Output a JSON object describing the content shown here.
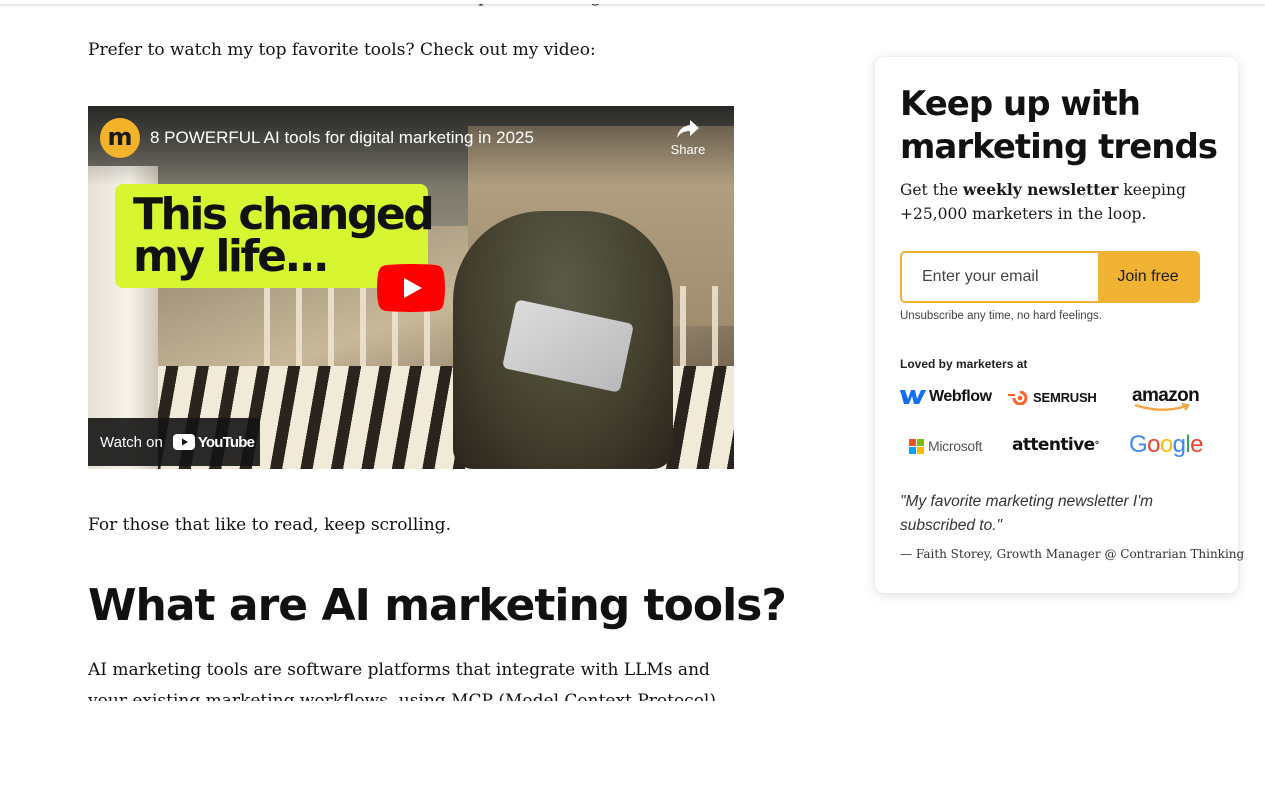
{
  "article": {
    "clipped_line": "Whether to save time, find new ideas or cheaper marketing execution.",
    "intro": "Prefer to watch my top favorite tools? Check out my video:",
    "scroll_note": "For those that like to read, keep scrolling.",
    "heading": "What are AI marketing tools?",
    "body": "AI marketing tools are software platforms that integrate with LLMs and your existing marketing workflows, using MCP (Model Context Protocol), to help"
  },
  "video": {
    "channel_logo_letter": "m",
    "title": "8 POWERFUL AI tools for digital marketing in 2025",
    "share_label": "Share",
    "thumbnail_text": "This changed\nmy life...",
    "watch_on_label": "Watch on",
    "youtube_wordmark": "YouTube",
    "icons": [
      "share-icon",
      "play-icon",
      "youtube-icon"
    ]
  },
  "newsletter": {
    "title": "Keep up with marketing trends",
    "subtitle_prefix": "Get the ",
    "subtitle_bold": "weekly newsletter",
    "subtitle_suffix": " keeping +25,000 marketers in the loop.",
    "email_placeholder": "Enter your email",
    "join_label": "Join free",
    "unsubscribe_note": "Unsubscribe any time, no hard feelings.",
    "loved_by": "Loved by marketers at",
    "logos": {
      "webflow": "Webflow",
      "semrush": "SEMRUSH",
      "amazon": "amazon",
      "microsoft": "Microsoft",
      "attentive": "attentive",
      "attentive_mark": "°",
      "google": [
        "G",
        "o",
        "o",
        "g",
        "l",
        "e"
      ]
    },
    "quote": "\"My favorite marketing newsletter I'm subscribed to.\"",
    "attribution": "— Faith Storey, Growth Manager @ Contrarian Thinking"
  },
  "colors": {
    "accent": "#f0b233",
    "thumbnail_green": "#d8f532",
    "youtube_red": "#ff0000",
    "semrush_orange": "#ff642d",
    "webflow_blue": "#146ef5",
    "google": [
      "#4285F4",
      "#EA4335",
      "#FBBC05",
      "#4285F4",
      "#34A853",
      "#EA4335"
    ],
    "microsoft": [
      "#F25022",
      "#7FBA00",
      "#00A4EF",
      "#FFB900"
    ]
  }
}
